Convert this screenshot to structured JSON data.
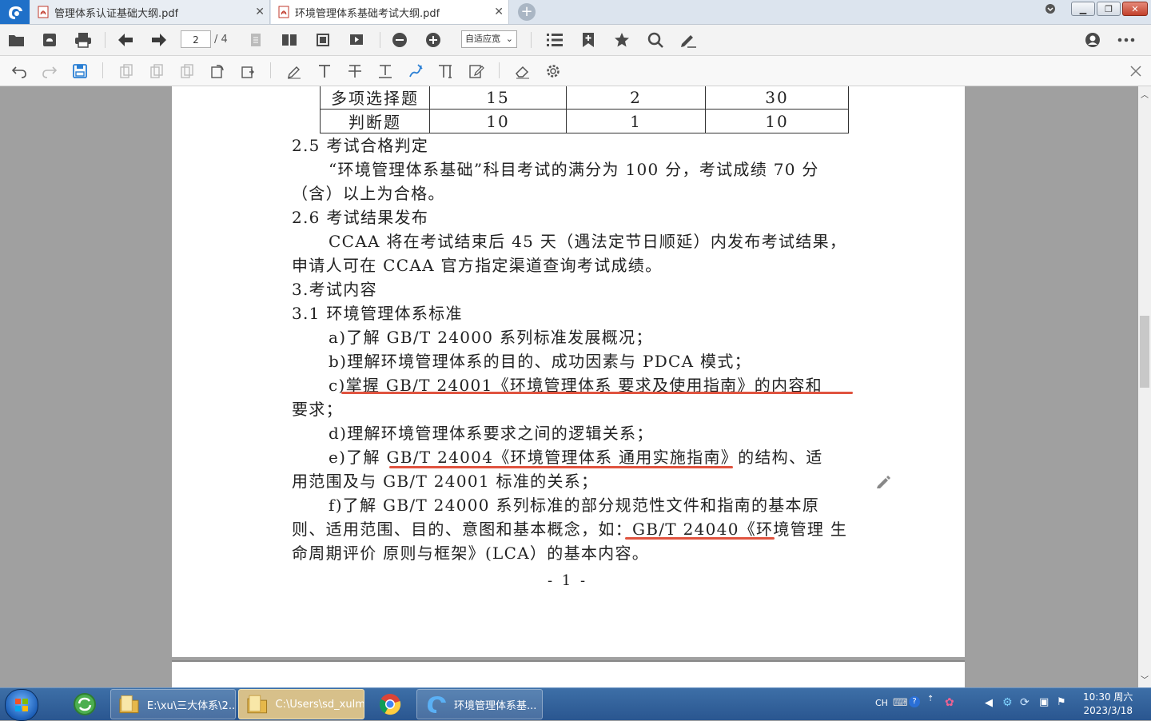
{
  "tabs": [
    {
      "label": "管理体系认证基础大纲.pdf",
      "active": false
    },
    {
      "label": "环境管理体系基础考试大纲.pdf",
      "active": true
    }
  ],
  "toolbar": {
    "current_page": "2",
    "total_pages": "/ 4",
    "zoom": "自适应宽"
  },
  "document": {
    "table_rows": [
      {
        "type": "多项选择题",
        "count": "15",
        "score_each": "2",
        "total": "30"
      },
      {
        "type": "判断题",
        "count": "10",
        "score_each": "1",
        "total": "10"
      }
    ],
    "lines": [
      "2.5 考试合格判定",
      "“环境管理体系基础”科目考试的满分为 100 分，考试成绩 70 分",
      "（含）以上为合格。",
      "2.6 考试结果发布",
      "CCAA 将在考试结束后 45 天（遇法定节日顺延）内发布考试结果，",
      "申请人可在 CCAA 官方指定渠道查询考试成绩。",
      "3.考试内容",
      "3.1 环境管理体系标准",
      "a)了解 GB/T 24000 系列标准发展概况；",
      "b)理解环境管理体系的目的、成功因素与 PDCA 模式；",
      "c)掌握 GB/T 24001《环境管理体系 要求及使用指南》的内容和",
      "要求；",
      "d)理解环境管理体系要求之间的逻辑关系；",
      "e)了解 GB/T 24004《环境管理体系 通用实施指南》的结构、适",
      "用范围及与 GB/T 24001 标准的关系；",
      "f)了解 GB/T 24000 系列标准的部分规范性文件和指南的基本原",
      "则、适用范围、目的、意图和基本概念，如：GB/T 24040《环境管理  生",
      "命周期评价 原则与框架》(LCA）的基本内容。"
    ],
    "page_number": "- 1 -",
    "annotation_color": "#e0533f"
  },
  "taskbar": {
    "items": [
      {
        "label": "E:\\xu\\三大体系\\2..."
      },
      {
        "label": "C:\\Users\\sd_xulm"
      },
      {
        "label": "环境管理体系基..."
      }
    ],
    "tray_lang": "CH",
    "clock_time": "10:30 周六",
    "clock_date": "2023/3/18"
  }
}
